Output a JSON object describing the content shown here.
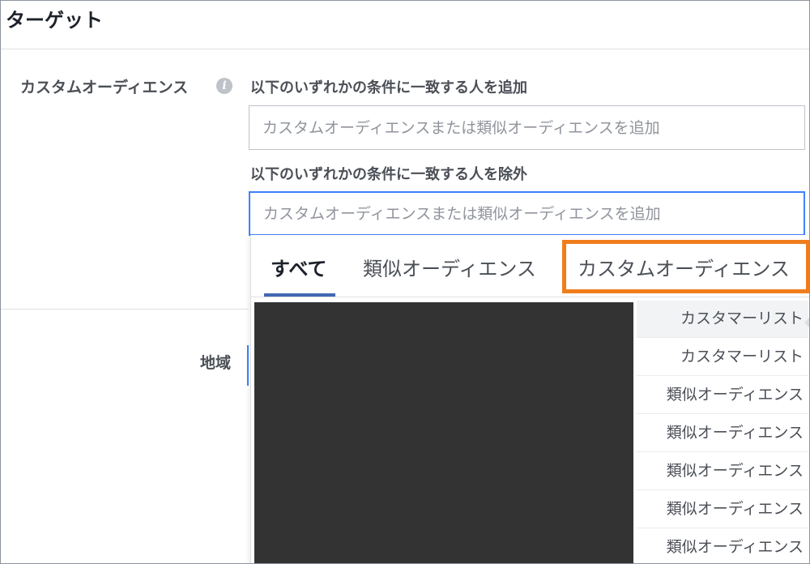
{
  "page": {
    "title": "ターゲット"
  },
  "custom_audience": {
    "label": "カスタムオーディエンス",
    "info_icon": "info-icon",
    "include_label": "以下のいずれかの条件に一致する人を追加",
    "include_placeholder": "カスタムオーディエンスまたは類似オーディエンスを追加",
    "exclude_label": "以下のいずれかの条件に一致する人を除外",
    "exclude_placeholder": "カスタムオーディエンスまたは類似オーディエンスを追加"
  },
  "region": {
    "label": "地域"
  },
  "dropdown": {
    "tabs": [
      {
        "label": "すべて",
        "active": true
      },
      {
        "label": "類似オーディエンス",
        "active": false
      },
      {
        "label": "カスタムオーディエンス",
        "active": false,
        "highlighted": true
      }
    ],
    "highlight_color": "#f07d1c",
    "items": [
      {
        "type": "カスタマーリスト"
      },
      {
        "type": "カスタマーリスト"
      },
      {
        "type": "類似オーディエンス"
      },
      {
        "type": "類似オーディエンス"
      },
      {
        "type": "類似オーディエンス"
      },
      {
        "type": "類似オーディエンス"
      },
      {
        "type": "類似オーディエンス"
      }
    ]
  },
  "colors": {
    "accent": "#4267b2",
    "focus_border": "#4080ff",
    "redaction": "#333333"
  }
}
